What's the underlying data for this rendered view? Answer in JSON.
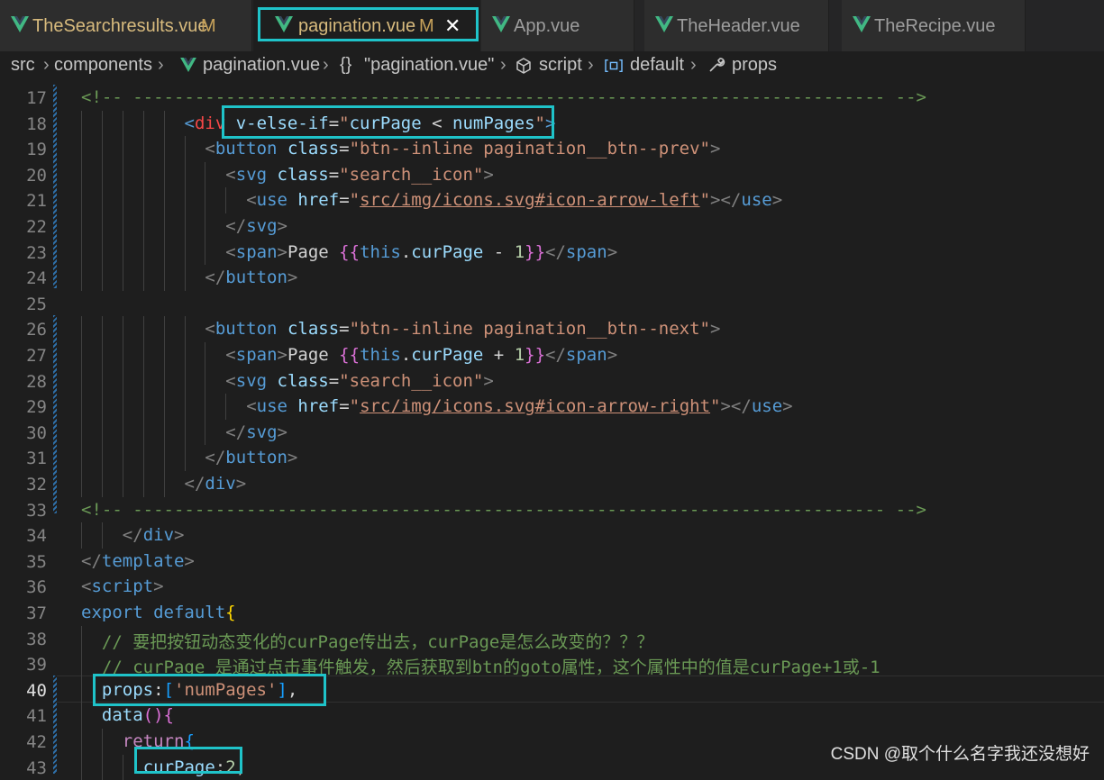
{
  "tabs": [
    {
      "name": "TheSearchresults.vue",
      "modified": "M"
    },
    {
      "name": "pagination.vue",
      "modified": "M",
      "close": "✕"
    },
    {
      "name": "App.vue"
    },
    {
      "name": "TheHeader.vue"
    },
    {
      "name": "TheRecipe.vue"
    }
  ],
  "breadcrumb": [
    "src",
    "components",
    "pagination.vue",
    "\"pagination.vue\"",
    "script",
    "default",
    "props"
  ],
  "lines": [
    {
      "n": "17",
      "segs": [
        [
          "cmt",
          "<!-- ------------------------------------------------------------------------- -->"
        ]
      ]
    },
    {
      "n": "18",
      "segs": [
        [
          "tag",
          "<"
        ],
        [
          "err",
          "div"
        ],
        [
          "txt",
          " "
        ],
        [
          "attr",
          "v-else-if"
        ],
        [
          "txt",
          "="
        ],
        [
          "str",
          "\""
        ],
        [
          "var",
          "curPage"
        ],
        [
          "txt",
          " < "
        ],
        [
          "var",
          "numPages"
        ],
        [
          "str",
          "\""
        ],
        [
          "tag",
          ">"
        ]
      ]
    },
    {
      "n": "19",
      "segs": [
        [
          "t",
          "<"
        ],
        [
          "tag",
          "button"
        ],
        [
          "txt",
          " "
        ],
        [
          "attr",
          "class"
        ],
        [
          "txt",
          "="
        ],
        [
          "str",
          "\"btn--inline pagination__btn--prev\""
        ],
        [
          "t",
          ">"
        ]
      ]
    },
    {
      "n": "20",
      "segs": [
        [
          "t",
          "<"
        ],
        [
          "tag",
          "svg"
        ],
        [
          "txt",
          " "
        ],
        [
          "attr",
          "class"
        ],
        [
          "txt",
          "="
        ],
        [
          "str",
          "\"search__icon\""
        ],
        [
          "t",
          ">"
        ]
      ]
    },
    {
      "n": "21",
      "segs": [
        [
          "t",
          "<"
        ],
        [
          "tag",
          "use"
        ],
        [
          "txt",
          " "
        ],
        [
          "attr",
          "href"
        ],
        [
          "txt",
          "="
        ],
        [
          "str",
          "\""
        ],
        [
          "strl",
          "src/img/icons.svg#icon-arrow-left"
        ],
        [
          "str",
          "\""
        ],
        [
          "t",
          "></"
        ],
        [
          "tag",
          "use"
        ],
        [
          "t",
          ">"
        ]
      ]
    },
    {
      "n": "22",
      "segs": [
        [
          "t",
          "</"
        ],
        [
          "tag",
          "svg"
        ],
        [
          "t",
          ">"
        ]
      ]
    },
    {
      "n": "23",
      "segs": [
        [
          "t",
          "<"
        ],
        [
          "tag",
          "span"
        ],
        [
          "t",
          ">"
        ],
        [
          "txt",
          "Page "
        ],
        [
          "br2",
          "{{"
        ],
        [
          "def",
          "this"
        ],
        [
          "txt",
          "."
        ],
        [
          "var",
          "curPage"
        ],
        [
          "txt",
          " - "
        ],
        [
          "num",
          "1"
        ],
        [
          "br2",
          "}}"
        ],
        [
          "t",
          "</"
        ],
        [
          "tag",
          "span"
        ],
        [
          "t",
          ">"
        ]
      ]
    },
    {
      "n": "24",
      "segs": [
        [
          "t",
          "</"
        ],
        [
          "tag",
          "button"
        ],
        [
          "t",
          ">"
        ]
      ]
    },
    {
      "n": "25",
      "segs": []
    },
    {
      "n": "26",
      "segs": [
        [
          "t",
          "<"
        ],
        [
          "tag",
          "button"
        ],
        [
          "txt",
          " "
        ],
        [
          "attr",
          "class"
        ],
        [
          "txt",
          "="
        ],
        [
          "str",
          "\"btn--inline pagination__btn--next\""
        ],
        [
          "t",
          ">"
        ]
      ]
    },
    {
      "n": "27",
      "segs": [
        [
          "t",
          "<"
        ],
        [
          "tag",
          "span"
        ],
        [
          "t",
          ">"
        ],
        [
          "txt",
          "Page "
        ],
        [
          "br2",
          "{{"
        ],
        [
          "def",
          "this"
        ],
        [
          "txt",
          "."
        ],
        [
          "var",
          "curPage"
        ],
        [
          "txt",
          " + "
        ],
        [
          "num",
          "1"
        ],
        [
          "br2",
          "}}"
        ],
        [
          "t",
          "</"
        ],
        [
          "tag",
          "span"
        ],
        [
          "t",
          ">"
        ]
      ]
    },
    {
      "n": "28",
      "segs": [
        [
          "t",
          "<"
        ],
        [
          "tag",
          "svg"
        ],
        [
          "txt",
          " "
        ],
        [
          "attr",
          "class"
        ],
        [
          "txt",
          "="
        ],
        [
          "str",
          "\"search__icon\""
        ],
        [
          "t",
          ">"
        ]
      ]
    },
    {
      "n": "29",
      "segs": [
        [
          "t",
          "<"
        ],
        [
          "tag",
          "use"
        ],
        [
          "txt",
          " "
        ],
        [
          "attr",
          "href"
        ],
        [
          "txt",
          "="
        ],
        [
          "str",
          "\""
        ],
        [
          "strl",
          "src/img/icons.svg#icon-arrow-right"
        ],
        [
          "str",
          "\""
        ],
        [
          "t",
          "></"
        ],
        [
          "tag",
          "use"
        ],
        [
          "t",
          ">"
        ]
      ]
    },
    {
      "n": "30",
      "segs": [
        [
          "t",
          "</"
        ],
        [
          "tag",
          "svg"
        ],
        [
          "t",
          ">"
        ]
      ]
    },
    {
      "n": "31",
      "segs": [
        [
          "t",
          "</"
        ],
        [
          "tag",
          "button"
        ],
        [
          "t",
          ">"
        ]
      ]
    },
    {
      "n": "32",
      "segs": [
        [
          "t",
          "</"
        ],
        [
          "tag",
          "div"
        ],
        [
          "t",
          ">"
        ]
      ]
    },
    {
      "n": "33",
      "segs": [
        [
          "cmt",
          "<!-- ------------------------------------------------------------------------- -->"
        ]
      ]
    },
    {
      "n": "34",
      "segs": [
        [
          "t",
          "</"
        ],
        [
          "tag",
          "div"
        ],
        [
          "t",
          ">"
        ]
      ]
    },
    {
      "n": "35",
      "segs": [
        [
          "t",
          "</"
        ],
        [
          "tag",
          "template"
        ],
        [
          "t",
          ">"
        ]
      ]
    },
    {
      "n": "36",
      "segs": [
        [
          "t",
          "<"
        ],
        [
          "tag",
          "script"
        ],
        [
          "t",
          ">"
        ]
      ]
    },
    {
      "n": "37",
      "segs": [
        [
          "def",
          "export"
        ],
        [
          "txt",
          " "
        ],
        [
          "def",
          "default"
        ],
        [
          "br1",
          "{"
        ]
      ]
    },
    {
      "n": "38",
      "segs": [
        [
          "cmt",
          "// 要把按钮动态变化的curPage传出去，curPage是怎么改变的？？？"
        ]
      ]
    },
    {
      "n": "39",
      "segs": [
        [
          "cmt",
          "// curPage 是通过点击事件触发，然后获取到btn的goto属性，这个属性中的值是curPage+1或-1"
        ]
      ]
    },
    {
      "n": "40",
      "segs": [
        [
          "var",
          "props"
        ],
        [
          "txt",
          ":"
        ],
        [
          "br3",
          "["
        ],
        [
          "str",
          "'numPages'"
        ],
        [
          "br3",
          "]"
        ],
        [
          "txt",
          ","
        ]
      ]
    },
    {
      "n": "41",
      "segs": [
        [
          "var",
          "data"
        ],
        [
          "br2",
          "()"
        ],
        [
          "br2",
          "{"
        ]
      ]
    },
    {
      "n": "42",
      "segs": [
        [
          "kw",
          "return"
        ],
        [
          "br3",
          "{"
        ]
      ]
    },
    {
      "n": "43",
      "segs": [
        [
          "var",
          "curPage"
        ],
        [
          "txt",
          ":"
        ],
        [
          "num",
          "2"
        ],
        [
          "txt",
          ","
        ]
      ]
    }
  ],
  "watermark": "CSDN @取个什么名字我还没想好"
}
